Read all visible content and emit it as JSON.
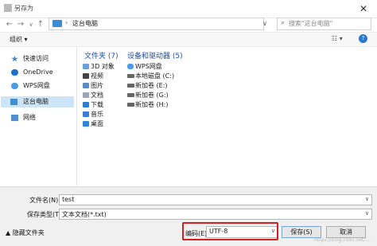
{
  "window": {
    "title": "另存为",
    "close_glyph": "✕"
  },
  "address_bar": {
    "back_glyph": "←",
    "forward_glyph": "→",
    "dropdown_glyph": "∨",
    "up_glyph": "↑",
    "separator": "›",
    "breadcrumb": "这台电脑",
    "refresh_glyph": "⟳",
    "caret_glyph": "∨"
  },
  "search": {
    "placeholder": "搜索\"这台电脑\""
  },
  "toolbar": {
    "organize": "组织 ▾",
    "view_glyph": "☷ ▾",
    "help_glyph": "?"
  },
  "nav_pane": {
    "items": [
      {
        "label": "快速访问",
        "icon": "star-icon"
      },
      {
        "label": "OneDrive",
        "icon": "cloud-icon"
      },
      {
        "label": "WPS网盘",
        "icon": "cloud-icon"
      },
      {
        "label": "这台电脑",
        "icon": "computer-icon",
        "selected": true
      },
      {
        "label": "网络",
        "icon": "network-icon"
      }
    ]
  },
  "folders_group": {
    "title": "文件夹 (7)",
    "items": [
      {
        "label": "3D 对象",
        "icon": "3d-objects-icon"
      },
      {
        "label": "视频",
        "icon": "video-icon"
      },
      {
        "label": "图片",
        "icon": "pictures-icon"
      },
      {
        "label": "文档",
        "icon": "documents-icon"
      },
      {
        "label": "下载",
        "icon": "downloads-icon"
      },
      {
        "label": "音乐",
        "icon": "music-icon"
      },
      {
        "label": "桌面",
        "icon": "desktop-icon"
      }
    ]
  },
  "drives_group": {
    "title": "设备和驱动器 (5)",
    "items": [
      {
        "label": "WPS网盘",
        "icon": "cloud-drive-icon"
      },
      {
        "label": "本地磁盘 (C:)",
        "icon": "drive-icon"
      },
      {
        "label": "新加卷 (E:)",
        "icon": "drive-icon"
      },
      {
        "label": "新加卷 (G:)",
        "icon": "drive-icon"
      },
      {
        "label": "新加卷 (H:)",
        "icon": "drive-icon"
      }
    ]
  },
  "form": {
    "filename_label": "文件名(N):",
    "filename_value": "test",
    "filetype_label": "保存类型(T):",
    "filetype_value": "文本文档(*.txt)",
    "dropdown_glyph": "∨",
    "hide_folders": "▲ 隐藏文件夹",
    "encoding_label": "编码(E):",
    "encoding_value": "UTF-8",
    "save_label": "保存(S)",
    "cancel_label": "取消"
  },
  "overlay": {
    "watermark": "https://blog.csdn.net/..."
  },
  "colors": {
    "accent": "#2b78d0",
    "highlight": "#d52020",
    "selected_bg": "#cce4f7"
  }
}
